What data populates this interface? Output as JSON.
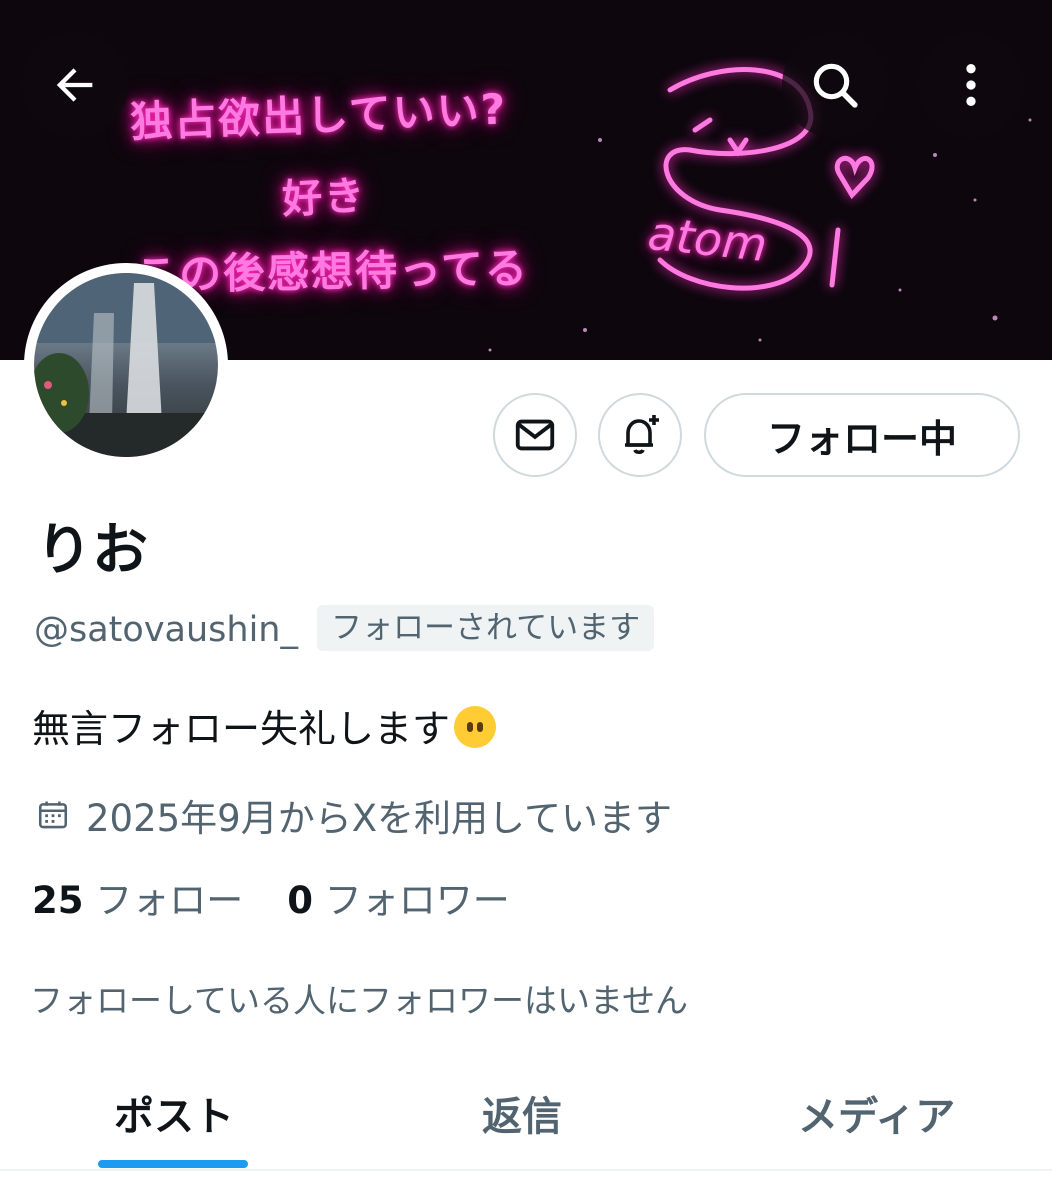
{
  "banner": {
    "line1": "独占欲出していい?",
    "line2": "好き",
    "line3": "この後感想待ってる",
    "signature": "atom"
  },
  "top_bar": {
    "back_icon": "back-arrow-icon",
    "search_icon": "search-icon",
    "more_icon": "more-vertical-icon"
  },
  "actions": {
    "message_icon": "mail-icon",
    "notify_icon": "bell-plus-icon",
    "follow_label": "フォロー中"
  },
  "profile": {
    "name": "りお",
    "handle": "@satovaushin_",
    "follows_you": "フォローされています",
    "bio": "無言フォロー失礼します",
    "bio_emoji": "dotted-face-emoji",
    "joined": "2025年9月からXを利用しています",
    "following_count": "25",
    "following_label": "フォロー",
    "followers_count": "0",
    "followers_label": "フォロワー",
    "mutual_note": "フォローしている人にフォロワーはいません"
  },
  "tabs": [
    {
      "label": "ポスト",
      "active": true
    },
    {
      "label": "返信",
      "active": false
    },
    {
      "label": "メディア",
      "active": false
    }
  ],
  "colors": {
    "accent": "#1d9bf0",
    "text_primary": "#0f1419",
    "text_secondary": "#536471",
    "neon_pink": "#ff7ae0"
  }
}
